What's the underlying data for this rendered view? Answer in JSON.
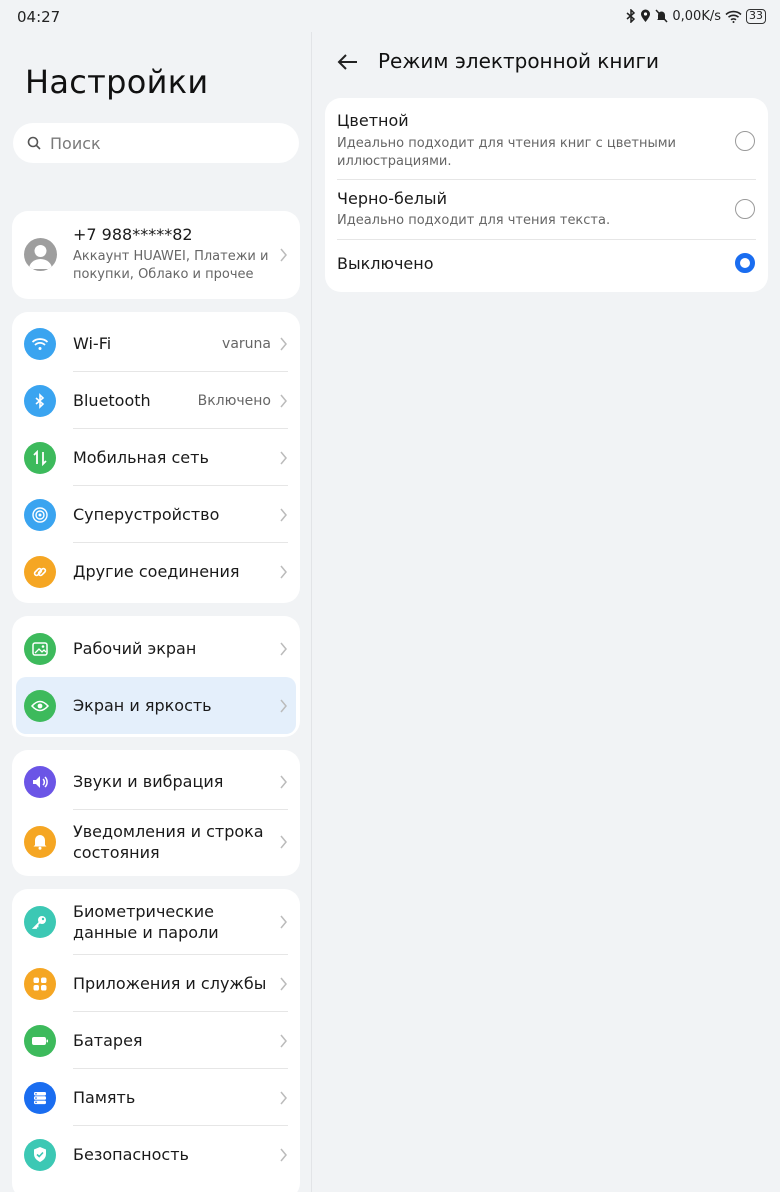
{
  "status_bar": {
    "time": "04:27",
    "network_speed": "0,00K/s",
    "battery": "33",
    "icons": [
      "bluetooth-icon",
      "location-icon",
      "mute-icon",
      "wifi-icon",
      "battery-icon"
    ]
  },
  "left_panel": {
    "title": "Настройки",
    "search_placeholder": "Поиск",
    "account": {
      "phone": "+7 988*****82",
      "subtitle": "Аккаунт HUAWEI, Платежи и покупки, Облако и прочее"
    },
    "groups": [
      [
        {
          "label": "Wi-Fi",
          "value": "varuna",
          "icon": "wifi-icon",
          "color": "#3aa4f0"
        },
        {
          "label": "Bluetooth",
          "value": "Включено",
          "icon": "bluetooth-icon",
          "color": "#3aa4f0"
        },
        {
          "label": "Мобильная сеть",
          "value": "",
          "icon": "mobile-data-icon",
          "color": "#3dba5c"
        },
        {
          "label": "Суперустройство",
          "value": "",
          "icon": "super-device-icon",
          "color": "#3aa4f0"
        },
        {
          "label": "Другие соединения",
          "value": "",
          "icon": "link-icon",
          "color": "#f5a623"
        }
      ],
      [
        {
          "label": "Рабочий экран",
          "value": "",
          "icon": "home-screen-icon",
          "color": "#3dba5c"
        },
        {
          "label": "Экран и яркость",
          "value": "",
          "icon": "eye-icon",
          "color": "#3dba5c",
          "selected": true
        }
      ],
      [
        {
          "label": "Звуки и вибрация",
          "value": "",
          "icon": "sound-icon",
          "color": "#6b55e6"
        },
        {
          "label": "Уведомления и строка состояния",
          "value": "",
          "icon": "bell-icon",
          "color": "#f5a623"
        }
      ],
      [
        {
          "label": "Биометрические данные и пароли",
          "value": "",
          "icon": "key-icon",
          "color": "#3cc8b4"
        },
        {
          "label": "Приложения и службы",
          "value": "",
          "icon": "apps-icon",
          "color": "#f5a623"
        },
        {
          "label": "Батарея",
          "value": "",
          "icon": "battery-icon",
          "color": "#3dba5c"
        },
        {
          "label": "Память",
          "value": "",
          "icon": "storage-icon",
          "color": "#1a6df0"
        },
        {
          "label": "Безопасность",
          "value": "",
          "icon": "shield-icon",
          "color": "#3cc8b4"
        }
      ]
    ]
  },
  "right_panel": {
    "title": "Режим электронной книги",
    "options": [
      {
        "name": "Цветной",
        "desc": "Идеально подходит для чтения книг с цветными иллюстрациями.",
        "selected": false
      },
      {
        "name": "Черно-белый",
        "desc": "Идеально подходит для чтения текста.",
        "selected": false
      },
      {
        "name": "Выключено",
        "desc": "",
        "selected": true
      }
    ]
  }
}
